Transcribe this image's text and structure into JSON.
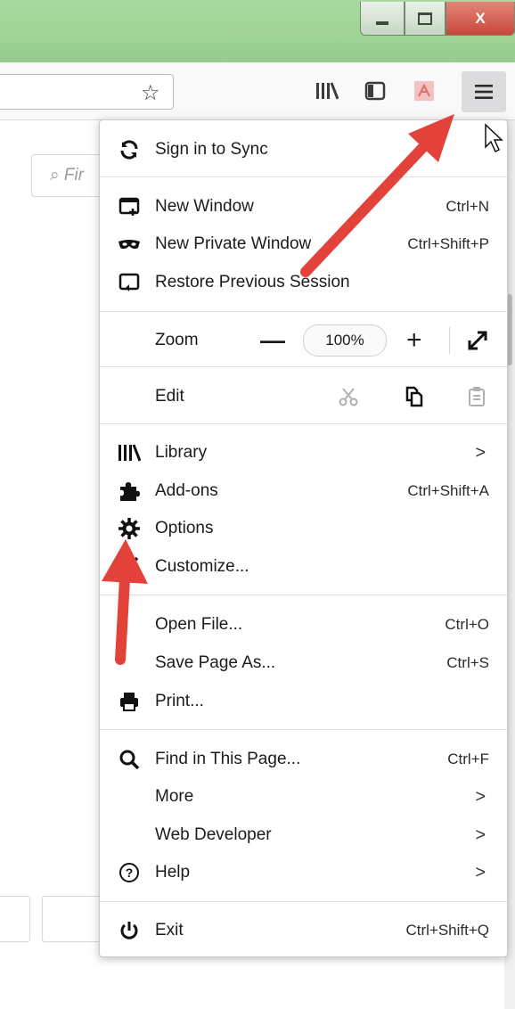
{
  "window": {
    "close_glyph": "X"
  },
  "toolbar": {
    "icons": [
      "star-icon",
      "library-icon",
      "sidebar-icon",
      "pdf-icon",
      "hamburger-menu-icon"
    ]
  },
  "page": {
    "search_placeholder": "Fir"
  },
  "menu": {
    "sign_in": "Sign in to Sync",
    "new_window": {
      "label": "New Window",
      "shortcut": "Ctrl+N"
    },
    "new_private_window": {
      "label": "New Private Window",
      "shortcut": "Ctrl+Shift+P"
    },
    "restore_session": {
      "label": "Restore Previous Session"
    },
    "zoom": {
      "label": "Zoom",
      "minus": "—",
      "value": "100%",
      "plus": "+"
    },
    "edit": {
      "label": "Edit"
    },
    "library": {
      "label": "Library",
      "arrow": ">"
    },
    "addons": {
      "label": "Add-ons",
      "shortcut": "Ctrl+Shift+A"
    },
    "options": {
      "label": "Options"
    },
    "customize": {
      "label": "Customize..."
    },
    "open_file": {
      "label": "Open File...",
      "shortcut": "Ctrl+O"
    },
    "save_page": {
      "label": "Save Page As...",
      "shortcut": "Ctrl+S"
    },
    "print": {
      "label": "Print..."
    },
    "find": {
      "label": "Find in This Page...",
      "shortcut": "Ctrl+F"
    },
    "more": {
      "label": "More",
      "arrow": ">"
    },
    "web_developer": {
      "label": "Web Developer",
      "arrow": ">"
    },
    "help": {
      "label": "Help",
      "arrow": ">"
    },
    "exit": {
      "label": "Exit",
      "shortcut": "Ctrl+Shift+Q"
    }
  },
  "colors": {
    "titlebar": "#9fd296",
    "annotation_arrow": "#e2423a",
    "close_button": "#c7473a"
  }
}
